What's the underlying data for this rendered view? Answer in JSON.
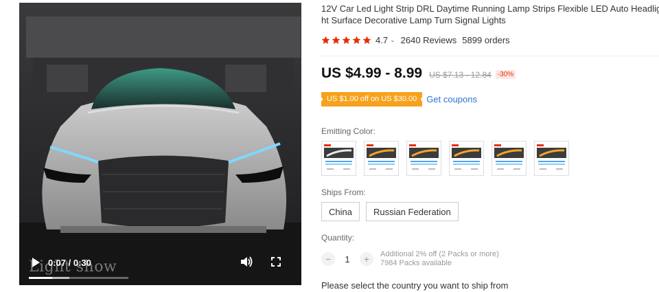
{
  "video": {
    "time_display": "0:07 / 0:30",
    "watermark": "Light show",
    "progress_fraction": 0.233,
    "buffered_fraction": 0.41
  },
  "product": {
    "title_line1": "12V Car Led Light Strip DRL Daytime Running Lamp Strips Flexible LED Auto Headlig",
    "title_line2": "ht Surface Decorative Lamp Turn Signal Lights",
    "rating": "4.7",
    "rating_caret": "⌄",
    "stars": 5,
    "reviews": "2640 Reviews",
    "orders": "5899 orders",
    "price": "US $4.99 - 8.99",
    "old_price": "US $7.13 - 12.84",
    "discount": "-30%",
    "coupon": "US $1.00 off on US $30.00",
    "get_coupons": "Get coupons"
  },
  "options": {
    "emitting_color_label": "Emitting Color:",
    "colors": [
      {
        "icon": "white-strip-thumbnail",
        "accent": "#e8e8e8"
      },
      {
        "icon": "blue-amber-strip-thumbnail",
        "accent": "#f5a623"
      },
      {
        "icon": "white-amber-strip-thumbnail",
        "accent": "#f5a623"
      },
      {
        "icon": "ice-blue-strip-thumbnail",
        "accent": "#f5a623"
      },
      {
        "icon": "white-amber-strip-thumbnail",
        "accent": "#f5a623"
      },
      {
        "icon": "blue-amber-strip-thumbnail",
        "accent": "#f5a623"
      }
    ],
    "ships_from_label": "Ships From:",
    "ships_from": [
      "China",
      "Russian Federation"
    ],
    "quantity_label": "Quantity:",
    "quantity": "1",
    "minus": "−",
    "plus": "+",
    "additional_discount": "Additional 2% off (2 Packs or more)",
    "available": "7984 Packs available",
    "ship_note": "Please select the country you want to ship from"
  },
  "colors": {
    "price_red": "#e62e04",
    "star_red": "#e62e04",
    "coupon_orange": "#f7a21c",
    "link_blue": "#2e73d0"
  }
}
